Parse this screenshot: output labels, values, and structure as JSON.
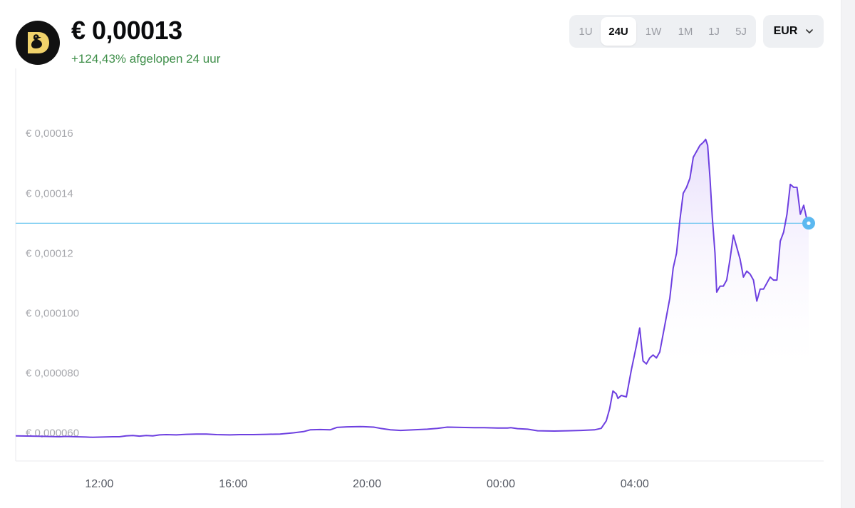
{
  "header": {
    "price": "€ 0,00013",
    "change": "+124,43% afgelopen 24 uur"
  },
  "ranges": [
    {
      "label": "1U",
      "active": false
    },
    {
      "label": "24U",
      "active": true
    },
    {
      "label": "1W",
      "active": false
    },
    {
      "label": "1M",
      "active": false
    },
    {
      "label": "1J",
      "active": false
    },
    {
      "label": "5J",
      "active": false
    }
  ],
  "currency": {
    "label": "EUR"
  },
  "colors": {
    "line": "#6d3fe0",
    "area_top": "#e6dcfb",
    "reference": "#5bc0ee",
    "marker": "#5bb8f0",
    "positive": "#3f8f4a"
  },
  "icons": {
    "logo": "duck-logo-icon",
    "dropdown": "chevron-down-icon"
  },
  "chart_data": {
    "type": "line",
    "x_unit": "hour of day",
    "x_ticks": [
      {
        "x": 12,
        "label": "12:00"
      },
      {
        "x": 16,
        "label": "16:00"
      },
      {
        "x": 20,
        "label": "20:00"
      },
      {
        "x": 24,
        "label": "00:00"
      },
      {
        "x": 28,
        "label": "04:00"
      }
    ],
    "y_ticks": [
      {
        "y": 6e-05,
        "label": "€ 0,000060"
      },
      {
        "y": 8e-05,
        "label": "€ 0,000080"
      },
      {
        "y": 0.0001,
        "label": "€ 0,000100"
      },
      {
        "y": 0.00012,
        "label": "€ 0,00012"
      },
      {
        "y": 0.00014,
        "label": "€ 0,00014"
      },
      {
        "y": 0.00016,
        "label": "€ 0,00016"
      }
    ],
    "xlim": [
      9.5,
      30.3
    ],
    "ylim": [
      5.06e-05,
      0.0001817
    ],
    "current_value": 0.00013,
    "series": [
      {
        "values": [
          [
            9.5,
            5.9e-05
          ],
          [
            10.0,
            5.89e-05
          ],
          [
            10.4,
            5.88e-05
          ],
          [
            10.8,
            5.87e-05
          ],
          [
            11.0,
            5.88e-05
          ],
          [
            11.3,
            5.87e-05
          ],
          [
            11.6,
            5.86e-05
          ],
          [
            11.8,
            5.85e-05
          ],
          [
            12.1,
            5.86e-05
          ],
          [
            12.4,
            5.87e-05
          ],
          [
            12.6,
            5.87e-05
          ],
          [
            12.8,
            5.9e-05
          ],
          [
            13.0,
            5.91e-05
          ],
          [
            13.2,
            5.89e-05
          ],
          [
            13.4,
            5.91e-05
          ],
          [
            13.6,
            5.9e-05
          ],
          [
            13.8,
            5.93e-05
          ],
          [
            14.0,
            5.94e-05
          ],
          [
            14.3,
            5.93e-05
          ],
          [
            14.6,
            5.95e-05
          ],
          [
            14.9,
            5.96e-05
          ],
          [
            15.2,
            5.96e-05
          ],
          [
            15.5,
            5.94e-05
          ],
          [
            15.9,
            5.93e-05
          ],
          [
            16.2,
            5.94e-05
          ],
          [
            16.6,
            5.94e-05
          ],
          [
            17.0,
            5.95e-05
          ],
          [
            17.4,
            5.96e-05
          ],
          [
            17.8,
            6e-05
          ],
          [
            18.1,
            6.04e-05
          ],
          [
            18.3,
            6.1e-05
          ],
          [
            18.6,
            6.11e-05
          ],
          [
            18.9,
            6.1e-05
          ],
          [
            19.1,
            6.18e-05
          ],
          [
            19.4,
            6.2e-05
          ],
          [
            19.8,
            6.21e-05
          ],
          [
            20.2,
            6.19e-05
          ],
          [
            20.4,
            6.15e-05
          ],
          [
            20.7,
            6.1e-05
          ],
          [
            21.0,
            6.08e-05
          ],
          [
            21.4,
            6.1e-05
          ],
          [
            21.8,
            6.12e-05
          ],
          [
            22.1,
            6.15e-05
          ],
          [
            22.4,
            6.19e-05
          ],
          [
            22.8,
            6.18e-05
          ],
          [
            23.2,
            6.17e-05
          ],
          [
            23.5,
            6.17e-05
          ],
          [
            23.9,
            6.16e-05
          ],
          [
            24.2,
            6.16e-05
          ],
          [
            24.3,
            6.17e-05
          ],
          [
            24.5,
            6.14e-05
          ],
          [
            24.8,
            6.12e-05
          ],
          [
            25.1,
            6.07e-05
          ],
          [
            25.6,
            6.06e-05
          ],
          [
            26.0,
            6.07e-05
          ],
          [
            26.4,
            6.08e-05
          ],
          [
            26.8,
            6.1e-05
          ],
          [
            27.0,
            6.15e-05
          ],
          [
            27.15,
            6.4e-05
          ],
          [
            27.25,
            6.8e-05
          ],
          [
            27.35,
            7.4e-05
          ],
          [
            27.45,
            7.3e-05
          ],
          [
            27.5,
            7.15e-05
          ],
          [
            27.6,
            7.25e-05
          ],
          [
            27.75,
            7.2e-05
          ],
          [
            27.9,
            8.1e-05
          ],
          [
            28.05,
            8.9e-05
          ],
          [
            28.15,
            9.5e-05
          ],
          [
            28.25,
            8.4e-05
          ],
          [
            28.35,
            8.3e-05
          ],
          [
            28.45,
            8.5e-05
          ],
          [
            28.55,
            8.6e-05
          ],
          [
            28.65,
            8.5e-05
          ],
          [
            28.75,
            8.7e-05
          ],
          [
            28.9,
            9.6e-05
          ],
          [
            29.05,
            0.000105
          ],
          [
            29.15,
            0.000115
          ],
          [
            29.25,
            0.00012
          ],
          [
            29.35,
            0.000131
          ],
          [
            29.45,
            0.00014
          ],
          [
            29.55,
            0.000142
          ],
          [
            29.65,
            0.000145
          ],
          [
            29.75,
            0.000152
          ],
          [
            29.85,
            0.000154
          ],
          [
            29.95,
            0.000156
          ],
          [
            30.05,
            0.000157
          ],
          [
            30.12,
            0.000158
          ],
          [
            30.18,
            0.000156
          ],
          [
            30.25,
            0.000145
          ],
          [
            30.32,
            0.000132
          ],
          [
            30.4,
            0.00012
          ],
          [
            30.45,
            0.000107
          ],
          [
            30.55,
            0.000109
          ],
          [
            30.65,
            0.000109
          ],
          [
            30.75,
            0.000111
          ],
          [
            30.85,
            0.000118
          ],
          [
            30.95,
            0.000126
          ],
          [
            31.05,
            0.000122
          ],
          [
            31.15,
            0.000118
          ],
          [
            31.25,
            0.000112
          ],
          [
            31.35,
            0.000114
          ],
          [
            31.45,
            0.000113
          ],
          [
            31.55,
            0.000111
          ],
          [
            31.65,
            0.000104
          ],
          [
            31.75,
            0.000108
          ],
          [
            31.85,
            0.000108
          ],
          [
            31.95,
            0.00011
          ],
          [
            32.05,
            0.000112
          ],
          [
            32.15,
            0.000111
          ],
          [
            32.25,
            0.000111
          ],
          [
            32.35,
            0.000124
          ],
          [
            32.45,
            0.000127
          ],
          [
            32.55,
            0.000133
          ],
          [
            32.65,
            0.000143
          ],
          [
            32.75,
            0.000142
          ],
          [
            32.85,
            0.000142
          ],
          [
            32.95,
            0.000133
          ],
          [
            33.05,
            0.000136
          ],
          [
            33.15,
            0.000131
          ],
          [
            33.2,
            0.00013
          ]
        ]
      }
    ]
  }
}
